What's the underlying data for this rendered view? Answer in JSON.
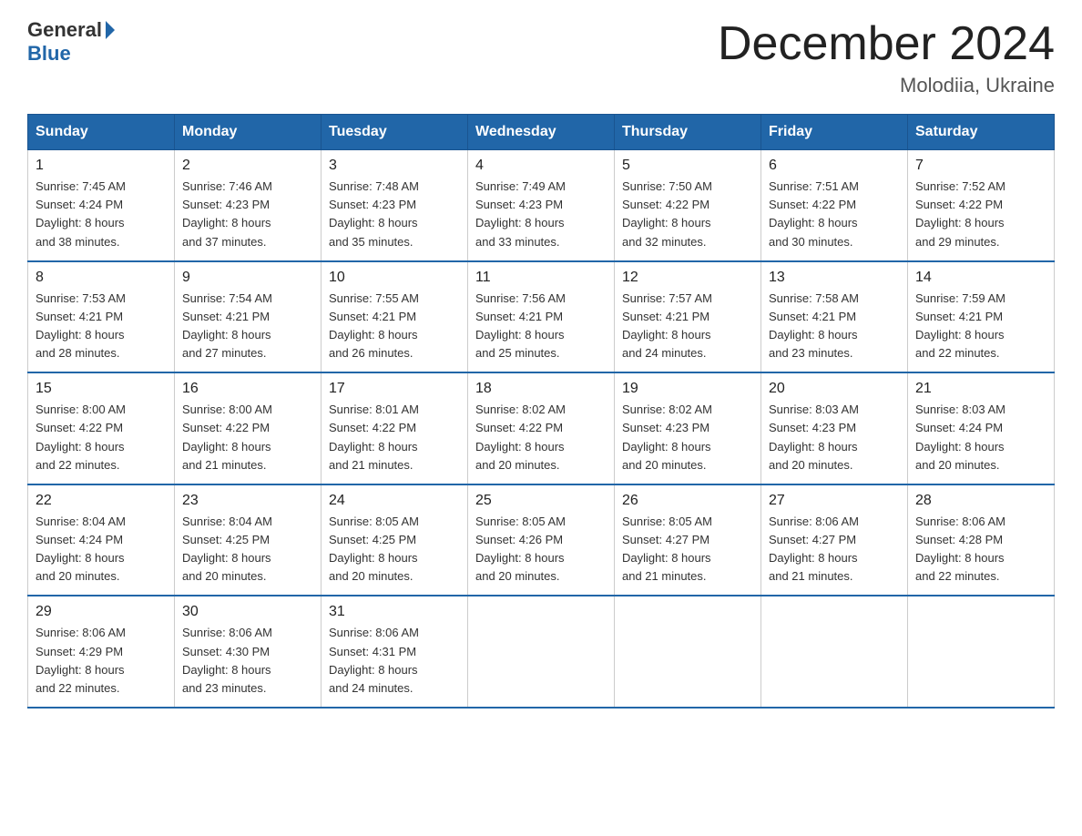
{
  "logo": {
    "general": "General",
    "blue": "Blue"
  },
  "header": {
    "title": "December 2024",
    "subtitle": "Molodiia, Ukraine"
  },
  "weekdays": [
    "Sunday",
    "Monday",
    "Tuesday",
    "Wednesday",
    "Thursday",
    "Friday",
    "Saturday"
  ],
  "weeks": [
    [
      {
        "day": "1",
        "sunrise": "7:45 AM",
        "sunset": "4:24 PM",
        "daylight": "8 hours and 38 minutes."
      },
      {
        "day": "2",
        "sunrise": "7:46 AM",
        "sunset": "4:23 PM",
        "daylight": "8 hours and 37 minutes."
      },
      {
        "day": "3",
        "sunrise": "7:48 AM",
        "sunset": "4:23 PM",
        "daylight": "8 hours and 35 minutes."
      },
      {
        "day": "4",
        "sunrise": "7:49 AM",
        "sunset": "4:23 PM",
        "daylight": "8 hours and 33 minutes."
      },
      {
        "day": "5",
        "sunrise": "7:50 AM",
        "sunset": "4:22 PM",
        "daylight": "8 hours and 32 minutes."
      },
      {
        "day": "6",
        "sunrise": "7:51 AM",
        "sunset": "4:22 PM",
        "daylight": "8 hours and 30 minutes."
      },
      {
        "day": "7",
        "sunrise": "7:52 AM",
        "sunset": "4:22 PM",
        "daylight": "8 hours and 29 minutes."
      }
    ],
    [
      {
        "day": "8",
        "sunrise": "7:53 AM",
        "sunset": "4:21 PM",
        "daylight": "8 hours and 28 minutes."
      },
      {
        "day": "9",
        "sunrise": "7:54 AM",
        "sunset": "4:21 PM",
        "daylight": "8 hours and 27 minutes."
      },
      {
        "day": "10",
        "sunrise": "7:55 AM",
        "sunset": "4:21 PM",
        "daylight": "8 hours and 26 minutes."
      },
      {
        "day": "11",
        "sunrise": "7:56 AM",
        "sunset": "4:21 PM",
        "daylight": "8 hours and 25 minutes."
      },
      {
        "day": "12",
        "sunrise": "7:57 AM",
        "sunset": "4:21 PM",
        "daylight": "8 hours and 24 minutes."
      },
      {
        "day": "13",
        "sunrise": "7:58 AM",
        "sunset": "4:21 PM",
        "daylight": "8 hours and 23 minutes."
      },
      {
        "day": "14",
        "sunrise": "7:59 AM",
        "sunset": "4:21 PM",
        "daylight": "8 hours and 22 minutes."
      }
    ],
    [
      {
        "day": "15",
        "sunrise": "8:00 AM",
        "sunset": "4:22 PM",
        "daylight": "8 hours and 22 minutes."
      },
      {
        "day": "16",
        "sunrise": "8:00 AM",
        "sunset": "4:22 PM",
        "daylight": "8 hours and 21 minutes."
      },
      {
        "day": "17",
        "sunrise": "8:01 AM",
        "sunset": "4:22 PM",
        "daylight": "8 hours and 21 minutes."
      },
      {
        "day": "18",
        "sunrise": "8:02 AM",
        "sunset": "4:22 PM",
        "daylight": "8 hours and 20 minutes."
      },
      {
        "day": "19",
        "sunrise": "8:02 AM",
        "sunset": "4:23 PM",
        "daylight": "8 hours and 20 minutes."
      },
      {
        "day": "20",
        "sunrise": "8:03 AM",
        "sunset": "4:23 PM",
        "daylight": "8 hours and 20 minutes."
      },
      {
        "day": "21",
        "sunrise": "8:03 AM",
        "sunset": "4:24 PM",
        "daylight": "8 hours and 20 minutes."
      }
    ],
    [
      {
        "day": "22",
        "sunrise": "8:04 AM",
        "sunset": "4:24 PM",
        "daylight": "8 hours and 20 minutes."
      },
      {
        "day": "23",
        "sunrise": "8:04 AM",
        "sunset": "4:25 PM",
        "daylight": "8 hours and 20 minutes."
      },
      {
        "day": "24",
        "sunrise": "8:05 AM",
        "sunset": "4:25 PM",
        "daylight": "8 hours and 20 minutes."
      },
      {
        "day": "25",
        "sunrise": "8:05 AM",
        "sunset": "4:26 PM",
        "daylight": "8 hours and 20 minutes."
      },
      {
        "day": "26",
        "sunrise": "8:05 AM",
        "sunset": "4:27 PM",
        "daylight": "8 hours and 21 minutes."
      },
      {
        "day": "27",
        "sunrise": "8:06 AM",
        "sunset": "4:27 PM",
        "daylight": "8 hours and 21 minutes."
      },
      {
        "day": "28",
        "sunrise": "8:06 AM",
        "sunset": "4:28 PM",
        "daylight": "8 hours and 22 minutes."
      }
    ],
    [
      {
        "day": "29",
        "sunrise": "8:06 AM",
        "sunset": "4:29 PM",
        "daylight": "8 hours and 22 minutes."
      },
      {
        "day": "30",
        "sunrise": "8:06 AM",
        "sunset": "4:30 PM",
        "daylight": "8 hours and 23 minutes."
      },
      {
        "day": "31",
        "sunrise": "8:06 AM",
        "sunset": "4:31 PM",
        "daylight": "8 hours and 24 minutes."
      },
      null,
      null,
      null,
      null
    ]
  ],
  "labels": {
    "sunrise": "Sunrise:",
    "sunset": "Sunset:",
    "daylight": "Daylight:"
  }
}
